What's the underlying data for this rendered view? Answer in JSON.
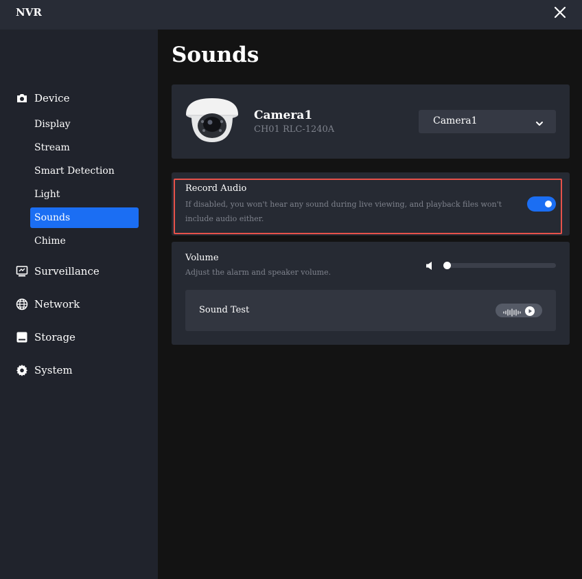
{
  "titlebar": {
    "title": "NVR",
    "close_icon": "close-icon"
  },
  "sidebar": {
    "groups": [
      {
        "label": "Device",
        "icon": "camera-icon"
      },
      {
        "label": "Surveillance",
        "icon": "surveillance-icon"
      },
      {
        "label": "Network",
        "icon": "globe-icon"
      },
      {
        "label": "Storage",
        "icon": "storage-icon"
      },
      {
        "label": "System",
        "icon": "gear-icon"
      }
    ],
    "device_items": [
      {
        "label": "Display"
      },
      {
        "label": "Stream"
      },
      {
        "label": "Smart Detection"
      },
      {
        "label": "Light"
      },
      {
        "label": "Sounds",
        "active": true
      },
      {
        "label": "Chime"
      }
    ]
  },
  "page": {
    "title": "Sounds"
  },
  "camera": {
    "name": "Camera1",
    "model": "CH01 RLC-1240A",
    "select_value": "Camera1"
  },
  "record_audio": {
    "title": "Record Audio",
    "description": "If disabled, you won't hear any sound during live viewing, and playback files won't include audio either.",
    "enabled": true
  },
  "volume": {
    "title": "Volume",
    "description": "Adjust the alarm and speaker volume.",
    "level": 0
  },
  "sound_test": {
    "label": "Sound Test"
  },
  "colors": {
    "accent": "#1b6ef3",
    "highlight": "#e8524a",
    "sidebar_bg": "#20232c",
    "card_bg": "#262a33"
  }
}
